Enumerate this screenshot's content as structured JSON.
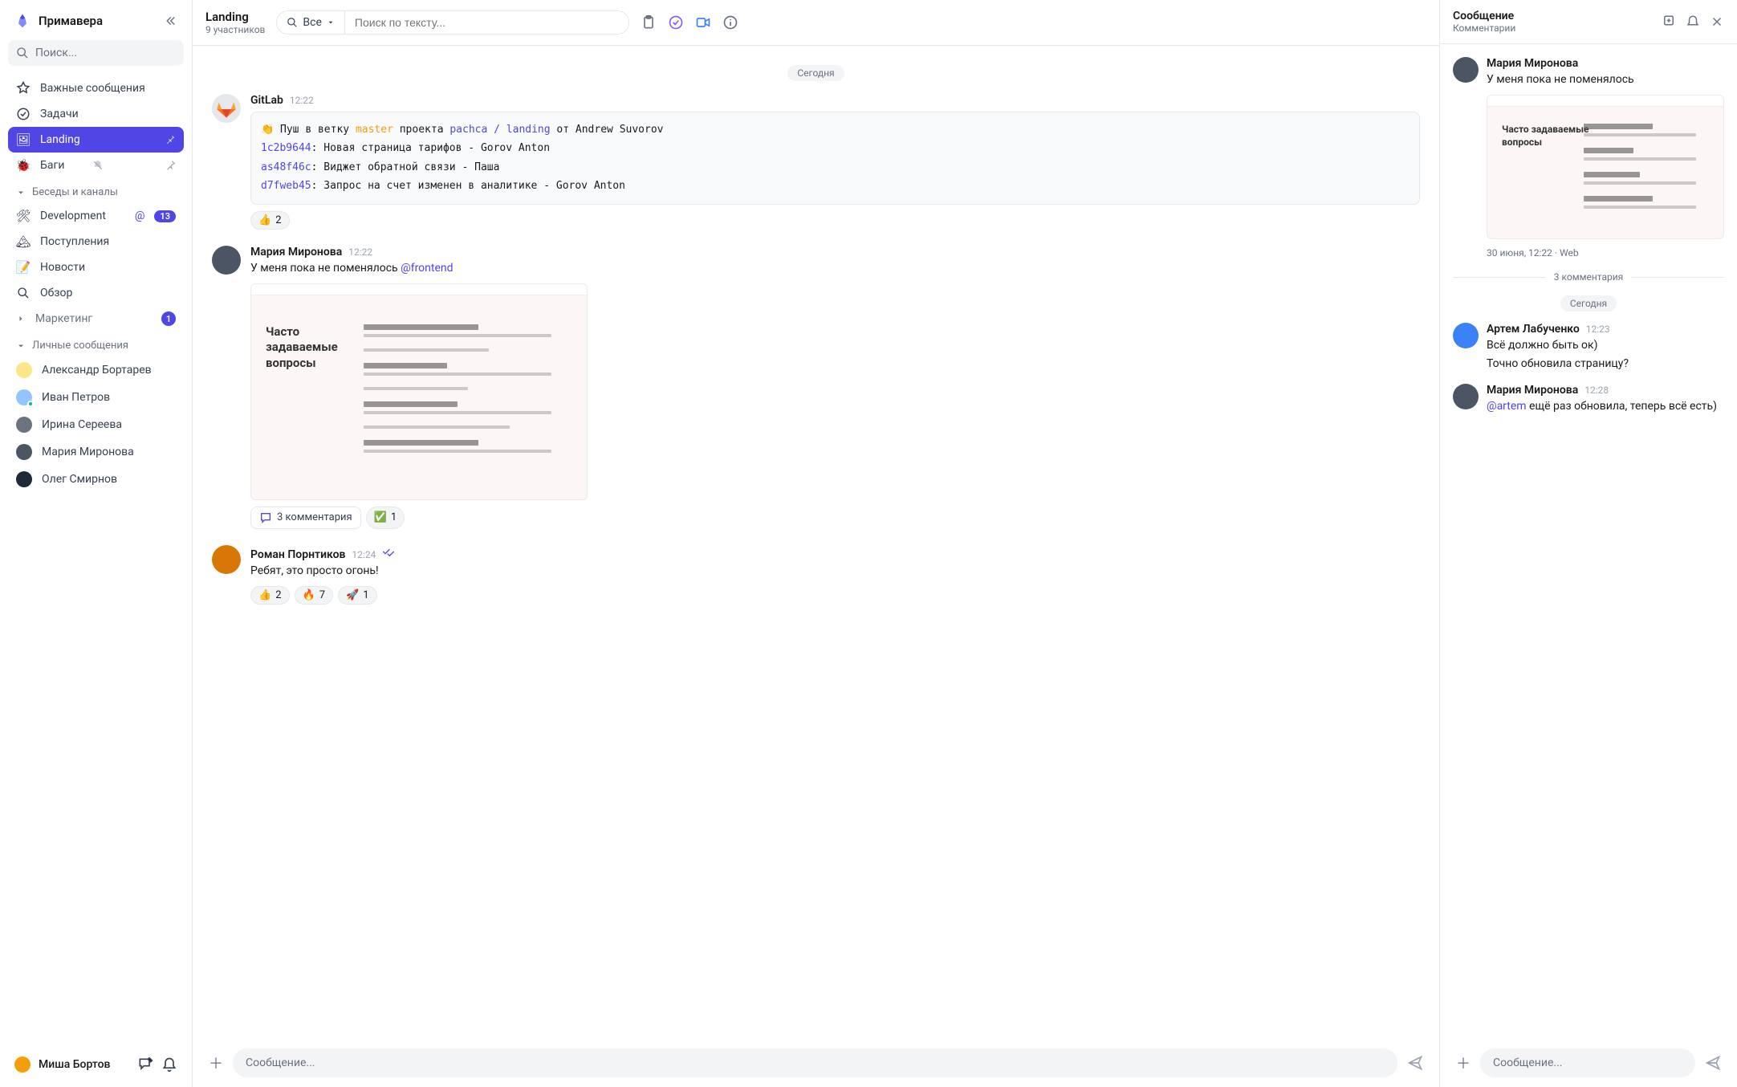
{
  "workspace": {
    "name": "Примавера"
  },
  "search_sidebar": {
    "placeholder": "Поиск..."
  },
  "nav": {
    "important": "Важные сообщения",
    "tasks": "Задачи"
  },
  "channels": [
    {
      "emoji": "🖼",
      "label": "Landing",
      "active": true,
      "pinned": true
    },
    {
      "emoji": "🐞",
      "label": "Баги",
      "muted": true
    }
  ],
  "section_channels": {
    "title": "Беседы и каналы",
    "items": [
      {
        "emoji": "🛠",
        "label": "Development",
        "mention": true,
        "badge": "13"
      },
      {
        "emoji": "🏔",
        "label": "Поступления"
      },
      {
        "emoji": "📝",
        "label": "Новости"
      },
      {
        "icon": "search",
        "label": "Обзор"
      }
    ]
  },
  "section_marketing": {
    "label": "Маркетинг",
    "badge": "1"
  },
  "section_dm": {
    "title": "Личные сообщения",
    "items": [
      {
        "label": "Александр Бортарев",
        "color": "#fde68a"
      },
      {
        "label": "Иван Петров",
        "color": "#93c5fd",
        "presence": true
      },
      {
        "label": "Ирина Сереева",
        "color": "#6b7280"
      },
      {
        "label": "Мария Миронова",
        "color": "#4b5563"
      },
      {
        "label": "Олег Смирнов",
        "color": "#1f2937"
      }
    ]
  },
  "current_user": {
    "name": "Миша Бортов"
  },
  "channel": {
    "title": "Landing",
    "subtitle": "9 участников"
  },
  "main_search": {
    "filter": "Все",
    "placeholder": "Поиск по тексту..."
  },
  "date_today": "Сегодня",
  "messages": {
    "gitlab": {
      "author": "GitLab",
      "time": "12:22",
      "push_prefix": "Пуш в ветку",
      "branch": "master",
      "project_word": "проекта",
      "project": "pachca / landing",
      "from": "от Andrew Suvorov",
      "commits": [
        {
          "hash": "1c2b9644",
          "msg": ": Новая страница тарифов - Gorov Anton"
        },
        {
          "hash": "as48f46c",
          "msg": ": Виджет обратной связи - Паша"
        },
        {
          "hash": "d7fweb45",
          "msg": ": Запрос на счет изменен в аналитике - Gorov Anton"
        }
      ],
      "reaction_emoji": "👍",
      "reaction_count": "2"
    },
    "maria": {
      "author": "Мария Миронова",
      "time": "12:22",
      "text": "У меня пока не поменялось ",
      "mention": "@frontend",
      "faq_title": "Часто задаваемые вопросы",
      "comments_label": "3 комментария",
      "reaction_emoji": "✅",
      "reaction_count": "1"
    },
    "roman": {
      "author": "Роман Порнтиков",
      "time": "12:24",
      "text": "Ребят, это просто огонь!",
      "reactions": [
        {
          "emoji": "👍",
          "count": "2"
        },
        {
          "emoji": "🔥",
          "count": "7"
        },
        {
          "emoji": "🚀",
          "count": "1"
        }
      ]
    }
  },
  "composer": {
    "placeholder": "Сообщение..."
  },
  "thread": {
    "title": "Сообщение",
    "subtitle": "Комментарии",
    "original": {
      "author": "Мария Миронова",
      "text": "У меня пока не поменялось",
      "faq_title": "Часто задаваемые вопросы",
      "meta": "30 июня, 12:22 · Web"
    },
    "divider": "3 комментария",
    "date": "Сегодня",
    "comments": [
      {
        "author": "Артем Лабученко",
        "time": "12:23",
        "lines": [
          "Всё должно быть ок)",
          "Точно обновила страницу?"
        ],
        "color": "#3b82f6"
      },
      {
        "author": "Мария Миронова",
        "time": "12:28",
        "mention": "@artem",
        "text": " ещё раз обновила, теперь всё есть)",
        "color": "#4b5563"
      }
    ],
    "composer_placeholder": "Сообщение..."
  }
}
